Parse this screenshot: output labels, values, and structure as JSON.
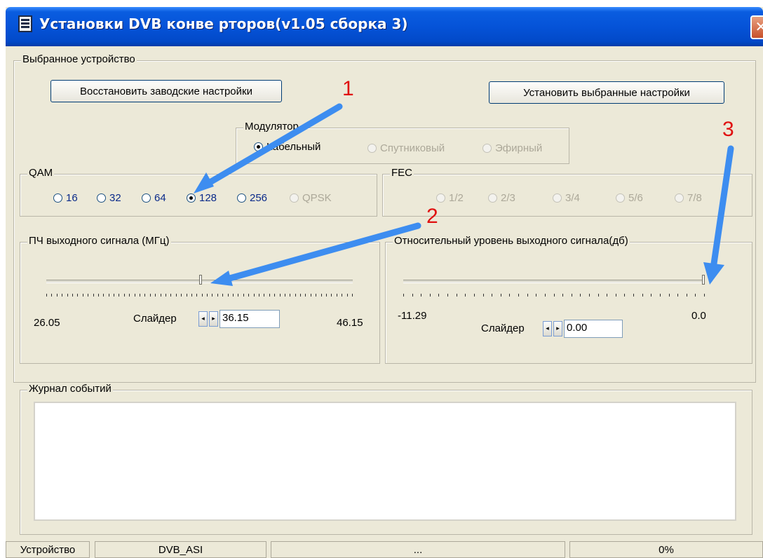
{
  "window": {
    "title": "Установки DVB конве рторов(v1.05 сборка 3)",
    "close_glyph": "✕"
  },
  "device_group": {
    "legend": "Выбранное устройство",
    "reset_button": "Восстановить заводские настройки",
    "apply_button": "Установить выбранные настройки"
  },
  "modulator": {
    "legend": "Модулятор",
    "options": [
      {
        "label": "Кабельный",
        "selected": true,
        "enabled": true
      },
      {
        "label": "Спутниковый",
        "selected": false,
        "enabled": false
      },
      {
        "label": "Эфирный",
        "selected": false,
        "enabled": false
      }
    ]
  },
  "qam": {
    "legend": "QAM",
    "options": [
      {
        "label": "16",
        "selected": false,
        "enabled": true
      },
      {
        "label": "32",
        "selected": false,
        "enabled": true
      },
      {
        "label": "64",
        "selected": false,
        "enabled": true
      },
      {
        "label": "128",
        "selected": true,
        "enabled": true
      },
      {
        "label": "256",
        "selected": false,
        "enabled": true
      },
      {
        "label": "QPSK",
        "selected": false,
        "enabled": false
      }
    ]
  },
  "fec": {
    "legend": "FEC",
    "options": [
      {
        "label": "1/2",
        "enabled": false
      },
      {
        "label": "2/3",
        "enabled": false
      },
      {
        "label": "3/4",
        "enabled": false
      },
      {
        "label": "5/6",
        "enabled": false
      },
      {
        "label": "7/8",
        "enabled": false
      }
    ]
  },
  "if_freq": {
    "legend": "ПЧ выходного сигнала (МГц)",
    "min_label": "26.05",
    "max_label": "46.15",
    "slider_label": "Слайдер",
    "value": "36.15",
    "min": 26.05,
    "max": 46.15
  },
  "level": {
    "legend": "Относительный уровень выходного сигнала(дб)",
    "min_label": "-11.29",
    "max_label": "0.0",
    "slider_label": "Слайдер",
    "value": "0.00",
    "min": -11.29,
    "max": 0.0
  },
  "log": {
    "legend": "Журнал событий"
  },
  "statusbar": {
    "device_label": "Устройство",
    "device_value": "DVB_ASI",
    "middle": "...",
    "progress": "0%"
  },
  "annotations": {
    "one": "1",
    "two": "2",
    "three": "3",
    "arrow_color": "#3d8df0",
    "number_color": "#e01010"
  },
  "icons": {
    "spin_left": "◂",
    "spin_right": "▸"
  }
}
